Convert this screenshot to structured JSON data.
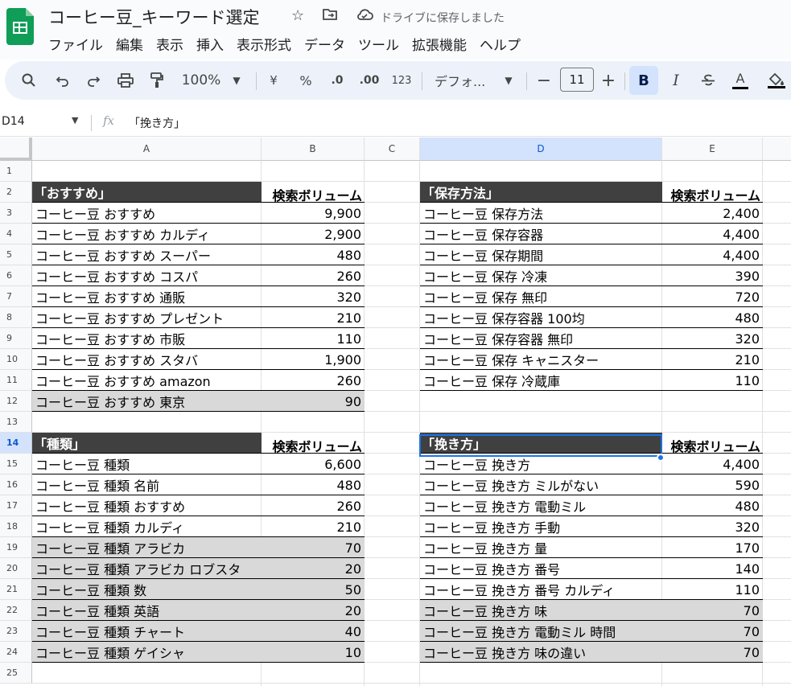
{
  "header": {
    "doc_title": "コーヒー豆_キーワード選定",
    "save_status": "ドライブに保存しました",
    "menu": [
      "ファイル",
      "編集",
      "表示",
      "挿入",
      "表示形式",
      "データ",
      "ツール",
      "拡張機能",
      "ヘルプ"
    ]
  },
  "toolbar": {
    "zoom": "100%",
    "currency": "¥",
    "percent": "%",
    "decimal_decrease": ".0",
    "decimal_increase": ".00",
    "number_format": "123",
    "font": "デフォ...",
    "font_size": "11",
    "bold": "B",
    "italic": "I",
    "text_color": "A"
  },
  "formula_bar": {
    "cell_ref": "D14",
    "fx": "fx",
    "content": "「挽き方」"
  },
  "grid": {
    "columns": [
      "A",
      "B",
      "C",
      "D",
      "E"
    ],
    "rows": [
      "1",
      "2",
      "3",
      "4",
      "5",
      "6",
      "7",
      "8",
      "9",
      "10",
      "11",
      "12",
      "13",
      "14",
      "15",
      "16",
      "17",
      "18",
      "19",
      "20",
      "21",
      "22",
      "23",
      "24",
      "25"
    ],
    "selected_column": "D",
    "selected_row": "14"
  },
  "tables": {
    "osusume": {
      "title": "「おすすめ」",
      "vol_header": "検索ボリューム",
      "rows": [
        {
          "kw": "コーヒー豆 おすすめ",
          "vol": "9,900",
          "gray": false
        },
        {
          "kw": "コーヒー豆 おすすめ カルディ",
          "vol": "2,900",
          "gray": false
        },
        {
          "kw": "コーヒー豆 おすすめ スーパー",
          "vol": "480",
          "gray": false
        },
        {
          "kw": "コーヒー豆 おすすめ コスパ",
          "vol": "260",
          "gray": false
        },
        {
          "kw": "コーヒー豆 おすすめ 通販",
          "vol": "320",
          "gray": false
        },
        {
          "kw": "コーヒー豆 おすすめ プレゼント",
          "vol": "210",
          "gray": false
        },
        {
          "kw": "コーヒー豆 おすすめ 市販",
          "vol": "110",
          "gray": false
        },
        {
          "kw": "コーヒー豆 おすすめ スタバ",
          "vol": "1,900",
          "gray": false
        },
        {
          "kw": "コーヒー豆 おすすめ amazon",
          "vol": "260",
          "gray": false
        },
        {
          "kw": "コーヒー豆 おすすめ 東京",
          "vol": "90",
          "gray": true
        }
      ]
    },
    "hozon": {
      "title": "「保存方法」",
      "vol_header": "検索ボリューム",
      "rows": [
        {
          "kw": "コーヒー豆 保存方法",
          "vol": "2,400",
          "gray": false
        },
        {
          "kw": "コーヒー豆 保存容器",
          "vol": "4,400",
          "gray": false
        },
        {
          "kw": "コーヒー豆 保存期間",
          "vol": "4,400",
          "gray": false
        },
        {
          "kw": "コーヒー豆 保存 冷凍",
          "vol": "390",
          "gray": false
        },
        {
          "kw": "コーヒー豆 保存 無印",
          "vol": "720",
          "gray": false
        },
        {
          "kw": "コーヒー豆 保存容器 100均",
          "vol": "480",
          "gray": false
        },
        {
          "kw": "コーヒー豆 保存容器 無印",
          "vol": "320",
          "gray": false
        },
        {
          "kw": "コーヒー豆 保存 キャニスター",
          "vol": "210",
          "gray": false
        },
        {
          "kw": "コーヒー豆 保存 冷蔵庫",
          "vol": "110",
          "gray": false
        }
      ]
    },
    "shurui": {
      "title": "「種類」",
      "vol_header": "検索ボリューム",
      "rows": [
        {
          "kw": "コーヒー豆 種類",
          "vol": "6,600",
          "gray": false
        },
        {
          "kw": "コーヒー豆 種類 名前",
          "vol": "480",
          "gray": false
        },
        {
          "kw": "コーヒー豆 種類 おすすめ",
          "vol": "260",
          "gray": false
        },
        {
          "kw": "コーヒー豆 種類 カルディ",
          "vol": "210",
          "gray": false
        },
        {
          "kw": "コーヒー豆 種類 アラビカ",
          "vol": "70",
          "gray": true
        },
        {
          "kw": "コーヒー豆 種類 アラビカ ロブスタ",
          "vol": "20",
          "gray": true
        },
        {
          "kw": "コーヒー豆 種類 数",
          "vol": "50",
          "gray": true
        },
        {
          "kw": "コーヒー豆 種類 英語",
          "vol": "20",
          "gray": true
        },
        {
          "kw": "コーヒー豆 種類 チャート",
          "vol": "40",
          "gray": true
        },
        {
          "kw": "コーヒー豆 種類 ゲイシャ",
          "vol": "10",
          "gray": true
        }
      ]
    },
    "hikikata": {
      "title": "「挽き方」",
      "vol_header": "検索ボリューム",
      "rows": [
        {
          "kw": "コーヒー豆 挽き方",
          "vol": "4,400",
          "gray": false
        },
        {
          "kw": "コーヒー豆 挽き方 ミルがない",
          "vol": "590",
          "gray": false
        },
        {
          "kw": "コーヒー豆 挽き方 電動ミル",
          "vol": "480",
          "gray": false
        },
        {
          "kw": "コーヒー豆 挽き方 手動",
          "vol": "320",
          "gray": false
        },
        {
          "kw": "コーヒー豆 挽き方 量",
          "vol": "170",
          "gray": false
        },
        {
          "kw": "コーヒー豆 挽き方 番号",
          "vol": "140",
          "gray": false
        },
        {
          "kw": "コーヒー豆 挽き方 番号 カルディ",
          "vol": "110",
          "gray": false
        },
        {
          "kw": "コーヒー豆 挽き方 味",
          "vol": "70",
          "gray": true
        },
        {
          "kw": "コーヒー豆 挽き方 電動ミル 時間",
          "vol": "70",
          "gray": true
        },
        {
          "kw": "コーヒー豆 挽き方 味の違い",
          "vol": "70",
          "gray": true
        }
      ]
    }
  }
}
